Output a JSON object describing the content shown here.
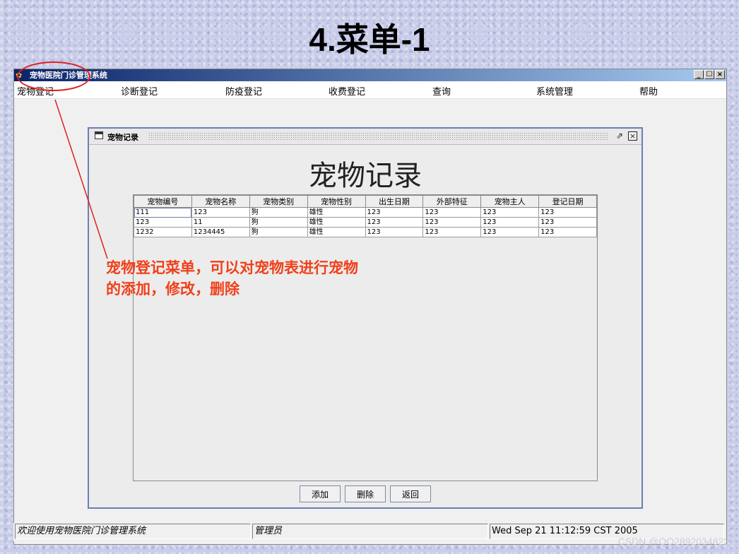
{
  "slide": {
    "title": "4.菜单-1"
  },
  "app": {
    "title": "宠物医院门诊管理系统",
    "window_buttons": [
      "_",
      "☐",
      "×"
    ],
    "menu": [
      "宠物登记",
      "诊断登记",
      "防疫登记",
      "收费登记",
      "查询",
      "系统管理",
      "帮助"
    ]
  },
  "frame": {
    "title": "宠物记录",
    "heading": "宠物记录",
    "columns": [
      "宠物编号",
      "宠物名称",
      "宠物类别",
      "宠物性别",
      "出生日期",
      "外部特征",
      "宠物主人",
      "登记日期"
    ],
    "rows": [
      [
        "111",
        "123",
        "狗",
        "雄性",
        "123",
        "123",
        "123",
        "123"
      ],
      [
        "123",
        "11",
        "狗",
        "雄性",
        "123",
        "123",
        "123",
        "123"
      ],
      [
        "1232",
        "1234445",
        "狗",
        "雄性",
        "123",
        "123",
        "123",
        "123"
      ]
    ],
    "buttons": {
      "add": "添加",
      "delete": "删除",
      "back": "返回"
    }
  },
  "annotation": {
    "line1": "宠物登记菜单，可以对宠物表进行宠物",
    "line2": "的添加，修改，删除",
    "color": "#f0401a"
  },
  "status": {
    "welcome": "欢迎使用宠物医院门诊管理系统",
    "role": "管理员",
    "datetime": "Wed Sep 21 11:12:59 CST 2005"
  },
  "watermark": "CSDN @QQ2892034822"
}
